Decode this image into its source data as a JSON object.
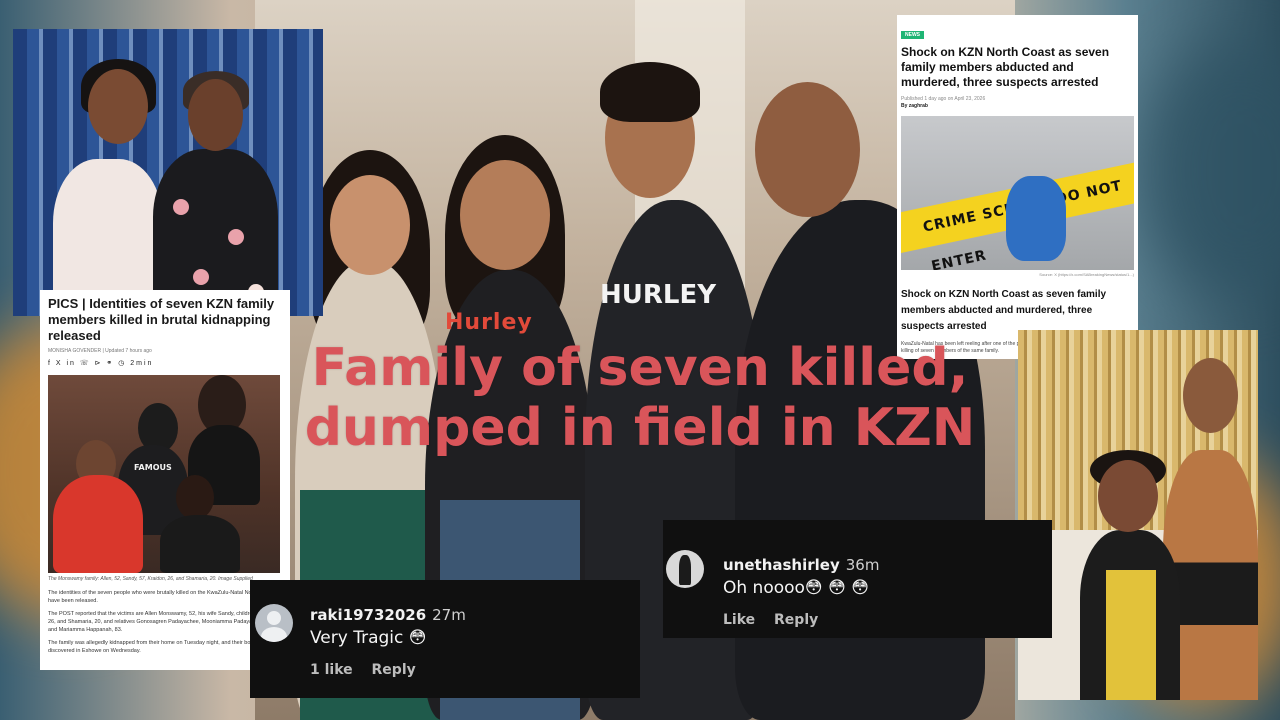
{
  "headline": {
    "line1": "Family of seven killed,",
    "line2": "dumped in field in KZN"
  },
  "article_left": {
    "title": "PICS | Identities of seven KZN family members killed in brutal kidnapping released",
    "meta": "MONISHA GOVENDER | Updated 7 hours ago",
    "share": "f X in ☏ ⊳ ⚭ ◷ 2min",
    "caption": "The Monswamy family: Allen, 52, Sandy, 57, Kraidon, 26, and Shamaria, 20. Image Supplied",
    "body": [
      "The identities of the seven people who were brutally killed on the KwaZulu-Natal North Coast have been released.",
      "The POST reported that the victims are Allen Monswamy, 52, his wife Sandy, children Kraidon, 26, and Shamaria, 20, and relatives Gonosagren Padayachee, Mooniamma Padayachee, 76, and Mariamma Happanah, 83.",
      "The family was allegedly kidnapped from their home on Tuesday night, and their bodies were discovered in Eshowe on Wednesday."
    ],
    "shirt_text": "FAMOUS"
  },
  "article_right": {
    "badge": "NEWS",
    "title": "Shock on KZN North Coast as seven family members abducted and murdered, three suspects arrested",
    "published": "Published 1 day ago on April 23, 2026",
    "byline": "By zaghrab",
    "tape_text": "CRIME SCENE - DO NOT ENTER",
    "credit": "Source: X (https://x.com/SABreakingNews/status/1...)",
    "title2": "Shock on KZN North Coast as seven family members abducted and murdered, three suspects arrested",
    "body": "KwaZulu-Natal has been left reeling after one of the province's most disturbing crimes the abduction and killing of seven members of the same family."
  },
  "family_photo": {
    "shirt1": "Hurley",
    "shirt2": "HURLEY"
  },
  "comments": [
    {
      "username": "raki19732026",
      "time": "27m",
      "text": "Very Tragic 😳",
      "likes": "1 like",
      "reply": "Reply"
    },
    {
      "username": "unethashirley",
      "time": "36m",
      "text": "Oh noooo😳 😳 😳",
      "likes": "Like",
      "reply": "Reply"
    }
  ],
  "colors": {
    "headline": "#d9555a",
    "comment_bg": "#101010",
    "news_badge": "#1fb574",
    "tape": "#f4d21f"
  }
}
